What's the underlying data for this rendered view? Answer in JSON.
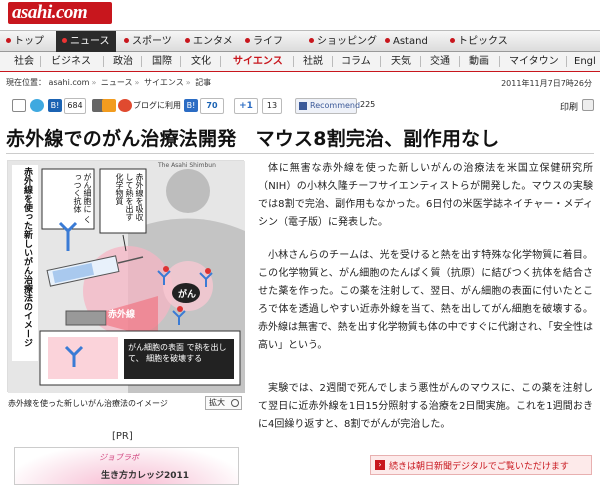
{
  "header": {
    "logo": "asahi.com"
  },
  "nav_primary": [
    {
      "label": "トップ"
    },
    {
      "label": "ニュース",
      "active": true
    },
    {
      "label": "スポーツ"
    },
    {
      "label": "エンタメ"
    },
    {
      "label": "ライフ"
    },
    {
      "label": "ショッピング"
    },
    {
      "label": "Astand"
    },
    {
      "label": "トピックス"
    }
  ],
  "nav_secondary": [
    {
      "label": "社会"
    },
    {
      "label": "ビジネス"
    },
    {
      "label": "政治"
    },
    {
      "label": "国際"
    },
    {
      "label": "文化"
    },
    {
      "label": "サイエンス",
      "active": true
    },
    {
      "label": "社説"
    },
    {
      "label": "コラム"
    },
    {
      "label": "天気"
    },
    {
      "label": "交通"
    },
    {
      "label": "動画"
    },
    {
      "label": "マイタウン"
    },
    {
      "label": "Engl"
    }
  ],
  "breadcrumb": {
    "prefix": "現在位置：",
    "items": [
      "asahi.com",
      "ニュース",
      "サイエンス",
      "記事"
    ]
  },
  "date": "2011年11月7日7時26分",
  "share": {
    "hatena_count": "684",
    "blog_label": "ブログに利用",
    "b_count": "70",
    "plus_count": "13",
    "recommend_label": "Recommend",
    "recommend_count": "225",
    "print_label": "印刷"
  },
  "headline": "赤外線でのがん治療法開発　マウス8割完治、副作用なし",
  "figure": {
    "vertical_title": "赤外線を使った新しいがん治療法のイメージ",
    "credit": "The Asahi Shimbun",
    "label_antibody": "がん細胞に くっつく抗体",
    "label_chemical": "赤外線を吸収 して熱を出す 化学物質",
    "label_infrared": "赤外線",
    "label_cancer": "がん",
    "label_bottom": "がん細胞の表面 で熱を出して、 細胞を破壊する",
    "caption": "赤外線を使った新しいがん治療法のイメージ",
    "zoom_label": "拡大"
  },
  "article": {
    "p1": "体に無害な赤外線を使った新しいがんの治療法を米国立保健研究所（NIH）の小林久隆チーフサイエンティストらが開発した。マウスの実験では8割で完治、副作用もなかった。6日付の米医学誌ネイチャー・メディシン（電子版）に発表した。",
    "p2": "小林さんらのチームは、光を受けると熱を出す特殊な化学物質に着目。この化学物質と、がん細胞のたんぱく質（抗原）に結びつく抗体を結合させた薬を作った。この薬を注射して、翌日、がん細胞の表面に付いたところで体を透過しやすい近赤外線を当て、熱を出してがん細胞を破壊する。赤外線は無害で、熱を出す化学物質も体の中ですぐに代謝され、「安全性は高い」という。",
    "p3": "実験では、2週間で死んでしまう悪性がんのマウスに、この薬を注射して翌日に近赤外線を1日15分照射する治療を2日間実施。これを1週間おきに4回繰り返すと、8割でがんが完治した。"
  },
  "pr_label": "[PR]",
  "ad": {
    "logo": "ジョブラボ",
    "text": "生き方カレッジ2011"
  },
  "digital_link": "続きは朝日新聞デジタルでご覧いただけます",
  "colors": {
    "brand": "#c8161d",
    "nav_active_bg": "#2b2b2b"
  }
}
